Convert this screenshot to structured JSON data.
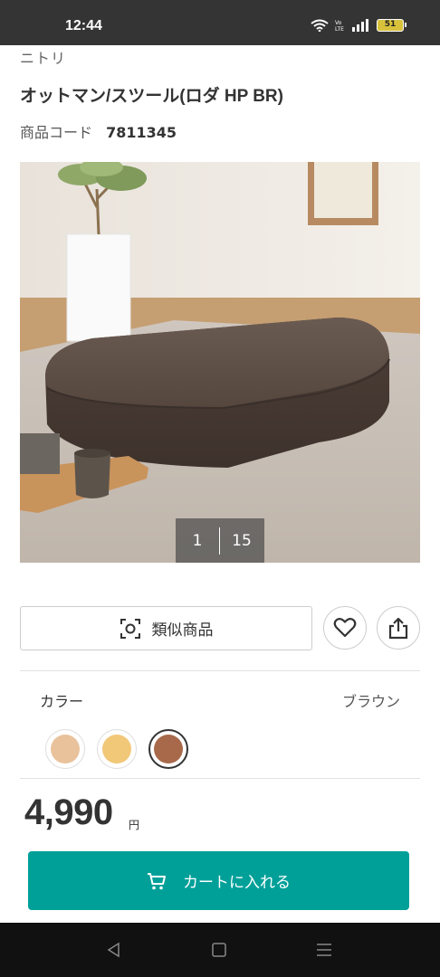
{
  "status_bar": {
    "time": "12:44",
    "battery": "51",
    "icons": [
      "wifi-icon",
      "volte-icon",
      "signal-icon",
      "battery-icon"
    ]
  },
  "product": {
    "brand": "ニトリ",
    "title": "オットマン/スツール(ロダ HP BR)",
    "code_label": "商品コード",
    "code_value": "7811345"
  },
  "gallery": {
    "current": "1",
    "total": "15"
  },
  "actions": {
    "similar_label": "類似商品",
    "similar_icon": "visual-search-icon",
    "favorite_icon": "heart-icon",
    "share_icon": "share-icon"
  },
  "color": {
    "label": "カラー",
    "selected_name": "ブラウン",
    "swatches": [
      {
        "color": "#e9c29c",
        "selected": false
      },
      {
        "color": "#f1c778",
        "selected": false
      },
      {
        "color": "#a8694a",
        "selected": true
      }
    ]
  },
  "price": {
    "amount": "4,990",
    "unit": "円"
  },
  "cart": {
    "label": "カートに入れる",
    "icon": "cart-icon",
    "color": "#00a099"
  },
  "nav": {
    "icons": [
      "back-icon",
      "home-icon",
      "menu-icon"
    ]
  }
}
